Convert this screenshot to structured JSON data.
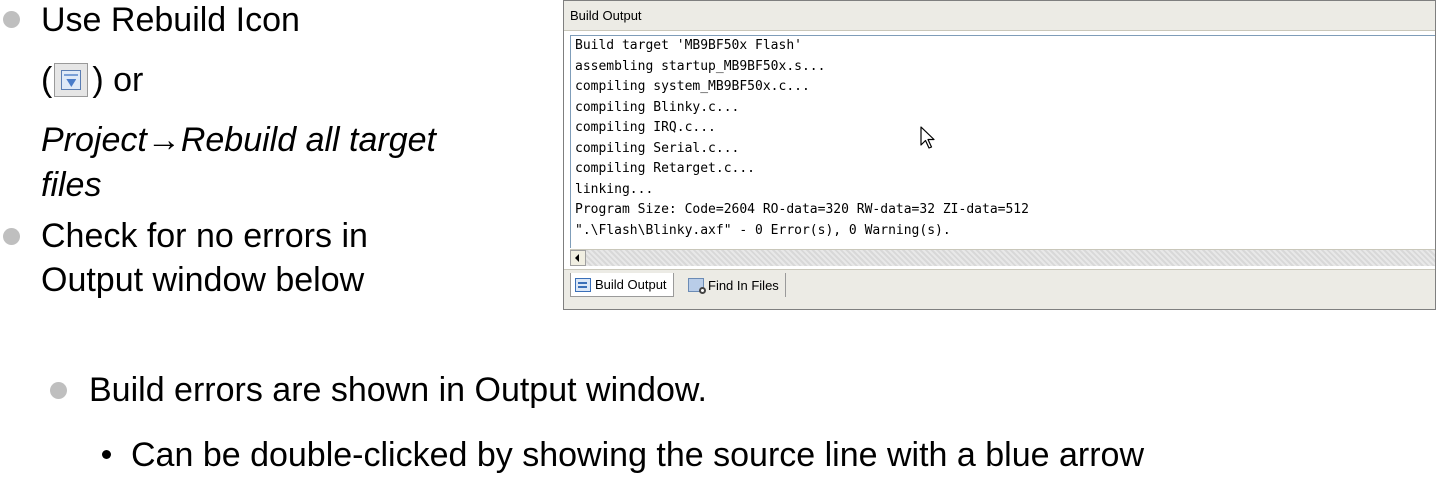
{
  "slide": {
    "bullets": [
      {
        "line1": "Use Rebuild Icon",
        "paren_open": "(",
        "paren_close": ") or",
        "line3": "Project→Rebuild all target",
        "line4": "files"
      },
      {
        "line1": "Check for no errors in",
        "line2": "Output window below"
      },
      {
        "line1": "Build errors are shown in Output window."
      }
    ],
    "sub_bullets": [
      "Can be double-clicked by showing the source line with a blue arrow"
    ]
  },
  "output_window": {
    "title": "Build Output",
    "lines": [
      "Build target 'MB9BF50x Flash'",
      "assembling startup_MB9BF50x.s...",
      "compiling system_MB9BF50x.c...",
      "compiling Blinky.c...",
      "compiling IRQ.c...",
      "compiling Serial.c...",
      "compiling Retarget.c...",
      "linking...",
      "Program Size: Code=2604 RO-data=320 RW-data=32 ZI-data=512",
      "\".\\Flash\\Blinky.axf\" - 0 Error(s), 0 Warning(s)."
    ],
    "tabs": [
      {
        "label": "Build Output",
        "icon": "build-output-icon",
        "active": true
      },
      {
        "label": "Find In Files",
        "icon": "find-in-files-icon",
        "active": false
      }
    ]
  },
  "icons": {
    "rebuild": "rebuild-icon",
    "cursor": "mouse-pointer-icon"
  },
  "colors": {
    "bullet": "#bfbfbf",
    "window_chrome": "#ecebe5",
    "border": "#7f9db9"
  }
}
